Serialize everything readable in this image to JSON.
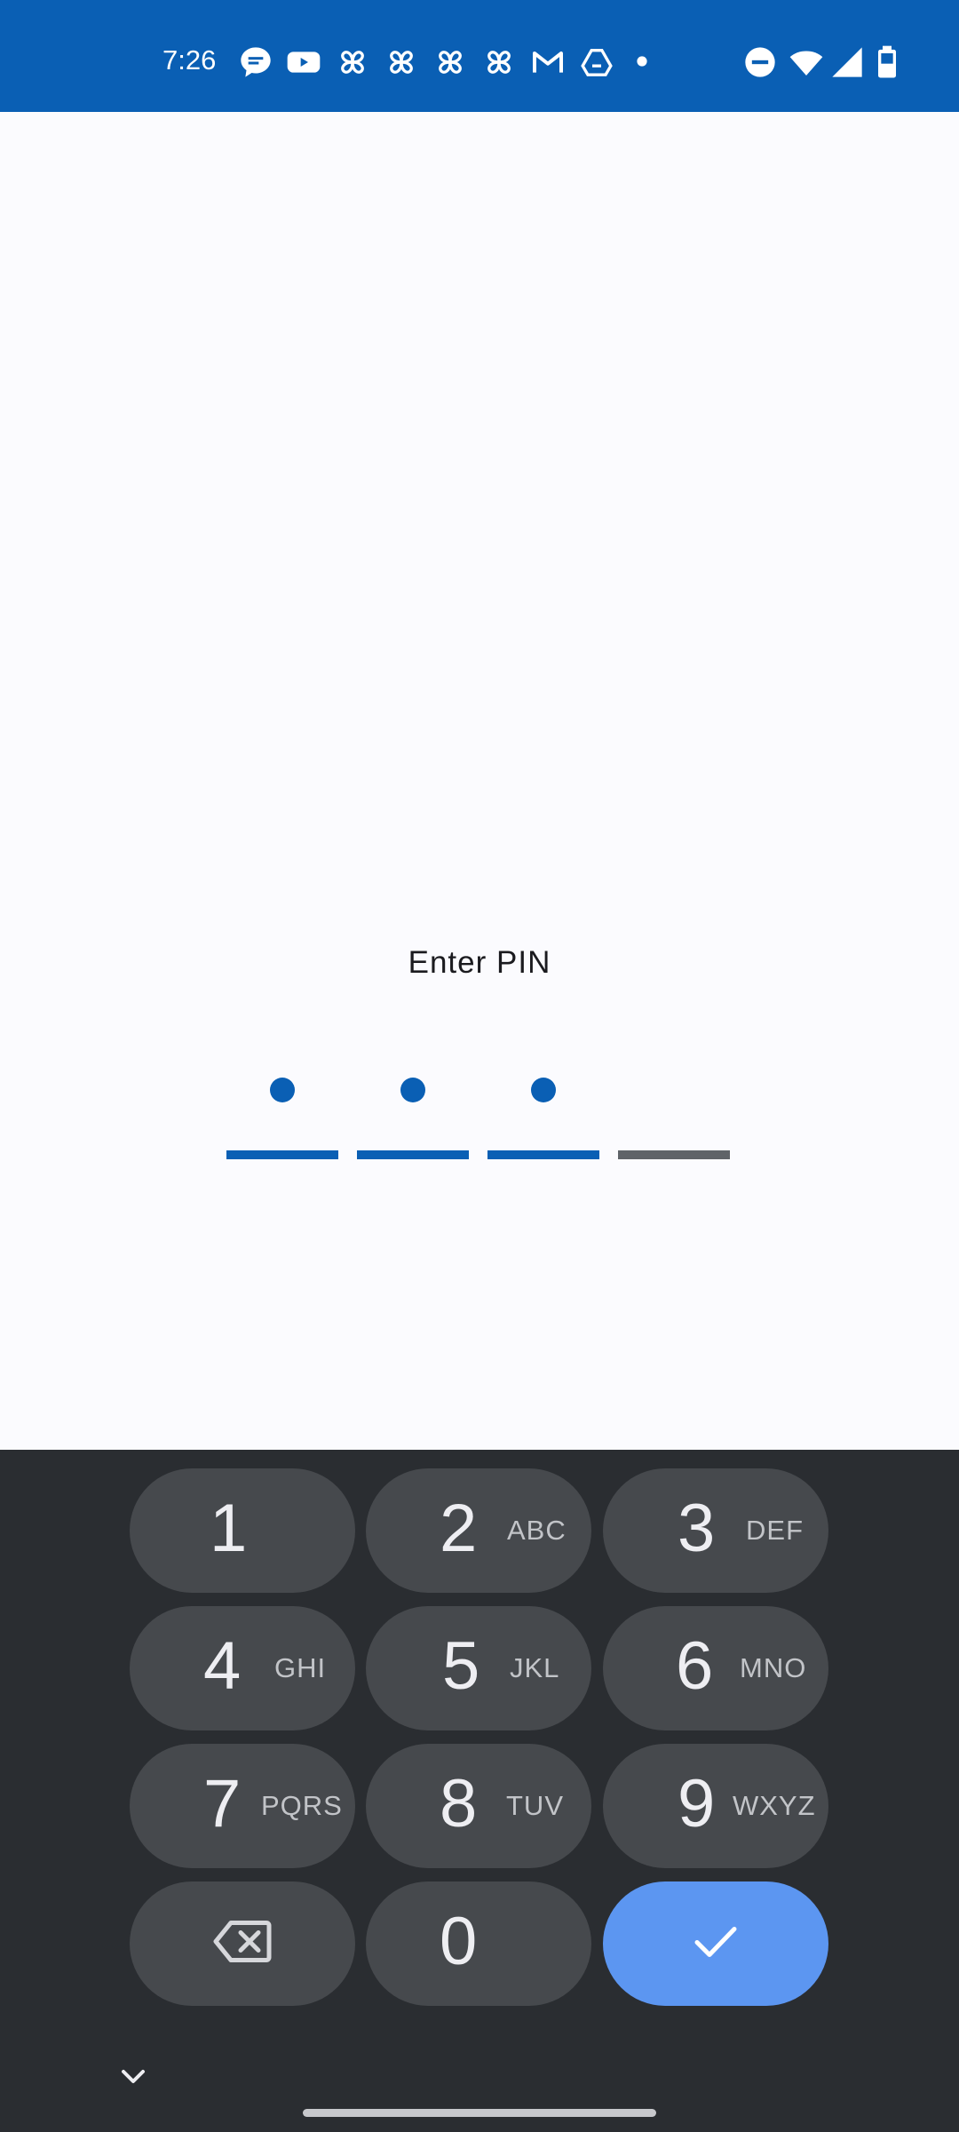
{
  "status_bar": {
    "time": "7:26",
    "notification_icons": [
      "messages-icon",
      "youtube-icon",
      "pinwheel-icon",
      "pinwheel-icon",
      "pinwheel-icon",
      "pinwheel-icon",
      "gmail-icon",
      "drive-icon",
      "more-dot-icon"
    ],
    "system_icons": [
      "do-not-disturb-icon",
      "wifi-icon",
      "signal-icon",
      "battery-icon"
    ]
  },
  "pin": {
    "title": "Enter PIN",
    "length": 4,
    "entered": 3,
    "active_color": "#0a5fb4",
    "inactive_color": "#5f6368"
  },
  "keypad": {
    "keys": [
      {
        "digit": "1",
        "letters": ""
      },
      {
        "digit": "2",
        "letters": "ABC"
      },
      {
        "digit": "3",
        "letters": "DEF"
      },
      {
        "digit": "4",
        "letters": "GHI"
      },
      {
        "digit": "5",
        "letters": "JKL"
      },
      {
        "digit": "6",
        "letters": "MNO"
      },
      {
        "digit": "7",
        "letters": "PQRS"
      },
      {
        "digit": "8",
        "letters": "TUV"
      },
      {
        "digit": "9",
        "letters": "WXYZ"
      },
      {
        "digit": "0",
        "letters": ""
      }
    ],
    "backspace_icon": "backspace-icon",
    "confirm_icon": "check-icon",
    "confirm_color": "#5c96f1",
    "collapse_icon": "chevron-down-icon"
  }
}
